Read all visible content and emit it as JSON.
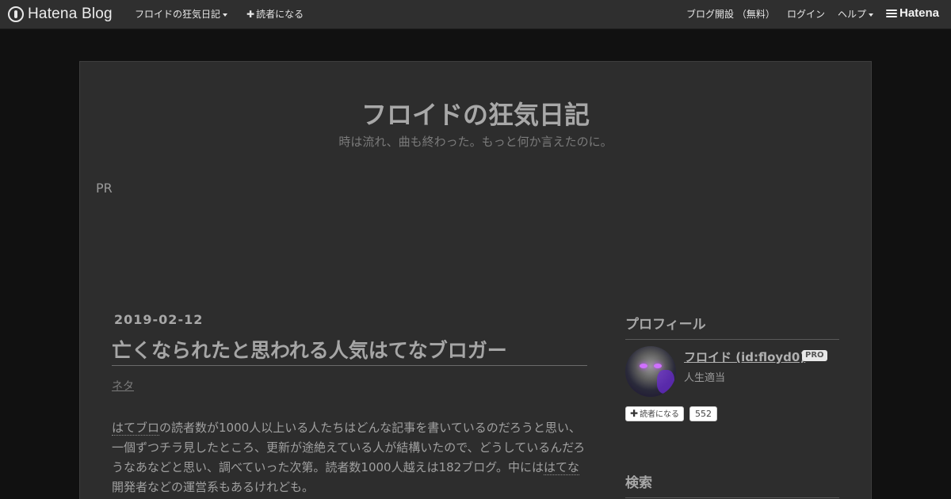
{
  "globalheader": {
    "logo_text": "Hatena Blog",
    "blog_menu": "フロイドの狂気日記",
    "subscribe": "読者になる",
    "open_blog": "ブログ開設 （無料）",
    "login": "ログイン",
    "help": "ヘルプ",
    "brand": "Hatena"
  },
  "blog": {
    "title": "フロイドの狂気日記",
    "description": "時は流れ、曲も終わった。もっと何か言えたのに。",
    "pr_label": "PR"
  },
  "entry": {
    "date": "2019-02-12",
    "title": "亡くなられたと思われる人気はてなブロガー",
    "category": "ネタ",
    "body": {
      "kw1": "はてブロ",
      "t1": "の読者数が1000人以上いる人たちはどんな記事を書いているのだろうと思い、一個ずつチラ見したところ、更新が途絶えている人が結構いたので、どうしているんだろうなあなどと思い、調べていった次第。読者数1000人越えは182ブログ。中には",
      "kw2": "はてな",
      "t2": "開発者などの運営系もあるけれども。"
    }
  },
  "sidebar": {
    "profile_heading": "プロフィール",
    "profile_name": "フロイド (id:floyd0)",
    "pro_badge": "PRO",
    "profile_desc": "人生適当",
    "follow_label": "読者になる",
    "follow_count": "552",
    "search_heading": "検索"
  },
  "icons": {
    "logo": "hatena-blog-logo-icon",
    "plus": "plus-icon",
    "caret": "caret-down-icon",
    "brand": "hatena-brand-icon"
  }
}
